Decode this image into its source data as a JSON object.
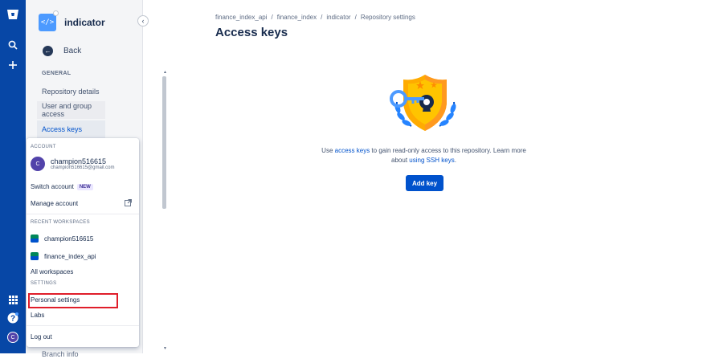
{
  "rail": {
    "icons": [
      "bitbucket-logo-icon",
      "search-icon",
      "create-icon",
      "app-switcher-icon",
      "help-icon",
      "profile-avatar"
    ],
    "avatar_letter": "C"
  },
  "sidebar": {
    "repo_name": "indicator",
    "back_label": "Back",
    "section_general": "GENERAL",
    "items": [
      {
        "label": "Repository details"
      },
      {
        "label": "User and group access"
      },
      {
        "label": "Access keys"
      }
    ],
    "hidden_item": "Branch info"
  },
  "account_menu": {
    "section_account": "ACCOUNT",
    "user_name": "champion516615",
    "user_email": "champion516615@gmail.com",
    "avatar_letter": "C",
    "switch_account": "Switch account",
    "new_badge": "NEW",
    "manage_account": "Manage account",
    "section_recent": "RECENT WORKSPACES",
    "workspaces": [
      "champion516615",
      "finance_index_api"
    ],
    "all_workspaces": "All workspaces",
    "section_settings": "SETTINGS",
    "personal_settings": "Personal settings",
    "labs": "Labs",
    "log_out": "Log out"
  },
  "main": {
    "breadcrumb": [
      "finance_index_api",
      "finance_index",
      "indicator",
      "Repository settings"
    ],
    "breadcrumb_sep": "/",
    "title": "Access keys",
    "desc_pre": "Use ",
    "desc_link1": "access keys",
    "desc_mid": " to gain read-only access to this repository. Learn more about ",
    "desc_link2": "using SSH keys",
    "desc_post": ".",
    "add_key_label": "Add key"
  },
  "colors": {
    "rail": "#0747a6",
    "primary": "#0052cc",
    "highlight_box": "#e01e2a",
    "shield": "#ffab00"
  }
}
